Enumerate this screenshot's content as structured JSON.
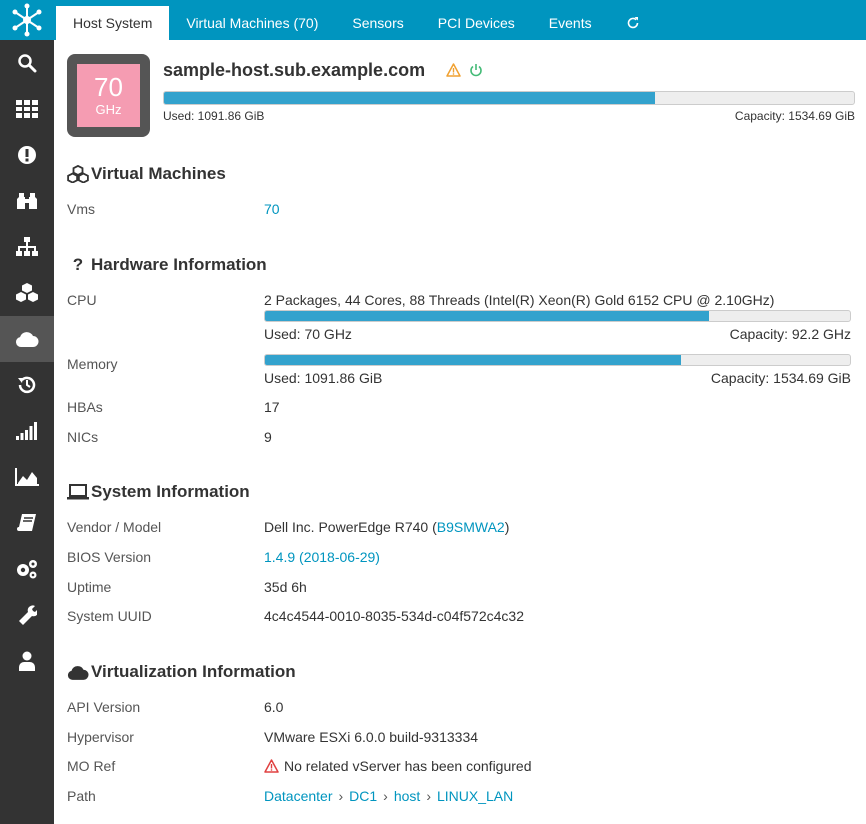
{
  "tabs": [
    {
      "label": "Host System",
      "active": true
    },
    {
      "label": "Virtual Machines (70)"
    },
    {
      "label": "Sensors"
    },
    {
      "label": "PCI Devices"
    },
    {
      "label": "Events"
    }
  ],
  "host": {
    "name": "sample-host.sub.example.com",
    "cpu_badge_value": "70",
    "cpu_badge_unit": "GHz",
    "storage_used": "Used: 1091.86 GiB",
    "storage_capacity": "Capacity: 1534.69 GiB",
    "storage_fraction": 0.711,
    "badge_color": "#f59cb2"
  },
  "vm_section": {
    "title": "Virtual Machines",
    "vms_label": "Vms",
    "vms_value": "70"
  },
  "hardware": {
    "title": "Hardware Information",
    "cpu_label": "CPU",
    "cpu_value": "2 Packages, 44 Cores, 88 Threads (Intel(R) Xeon(R) Gold 6152 CPU @ 2.10GHz)",
    "cpu_used": "Used: 70 GHz",
    "cpu_capacity": "Capacity: 92.2 GHz",
    "cpu_fraction": 0.759,
    "memory_label": "Memory",
    "memory_used": "Used: 1091.86 GiB",
    "memory_capacity": "Capacity: 1534.69 GiB",
    "memory_fraction": 0.711,
    "hbas_label": "HBAs",
    "hbas_value": "17",
    "nics_label": "NICs",
    "nics_value": "9"
  },
  "system": {
    "title": "System Information",
    "vendor_label": "Vendor / Model",
    "vendor_value": "Dell Inc. PowerEdge R740 (",
    "vendor_serial": "B9SMWA2",
    "vendor_close": ")",
    "bios_label": "BIOS Version",
    "bios_value": "1.4.9 (2018-06-29)",
    "uptime_label": "Uptime",
    "uptime_value": "35d 6h",
    "uuid_label": "System UUID",
    "uuid_value": "4c4c4544-0010-8035-534d-c04f572c4c32"
  },
  "virtualization": {
    "title": "Virtualization Information",
    "api_label": "API Version",
    "api_value": "6.0",
    "hypervisor_label": "Hypervisor",
    "hypervisor_value": "VMware ESXi 6.0.0 build-9313334",
    "moref_label": "MO Ref",
    "moref_value": "No related vServer has been configured",
    "path_label": "Path",
    "path": [
      "Datacenter",
      "DC1",
      "host",
      "LINUX_LAN"
    ],
    "path_separator": "›"
  },
  "colors": {
    "accent": "#0095bf",
    "sidebar": "#333333",
    "bar_fill": "#33a2cd",
    "warning": "#f0a030",
    "ok": "#44bb77",
    "error": "#e04040"
  }
}
